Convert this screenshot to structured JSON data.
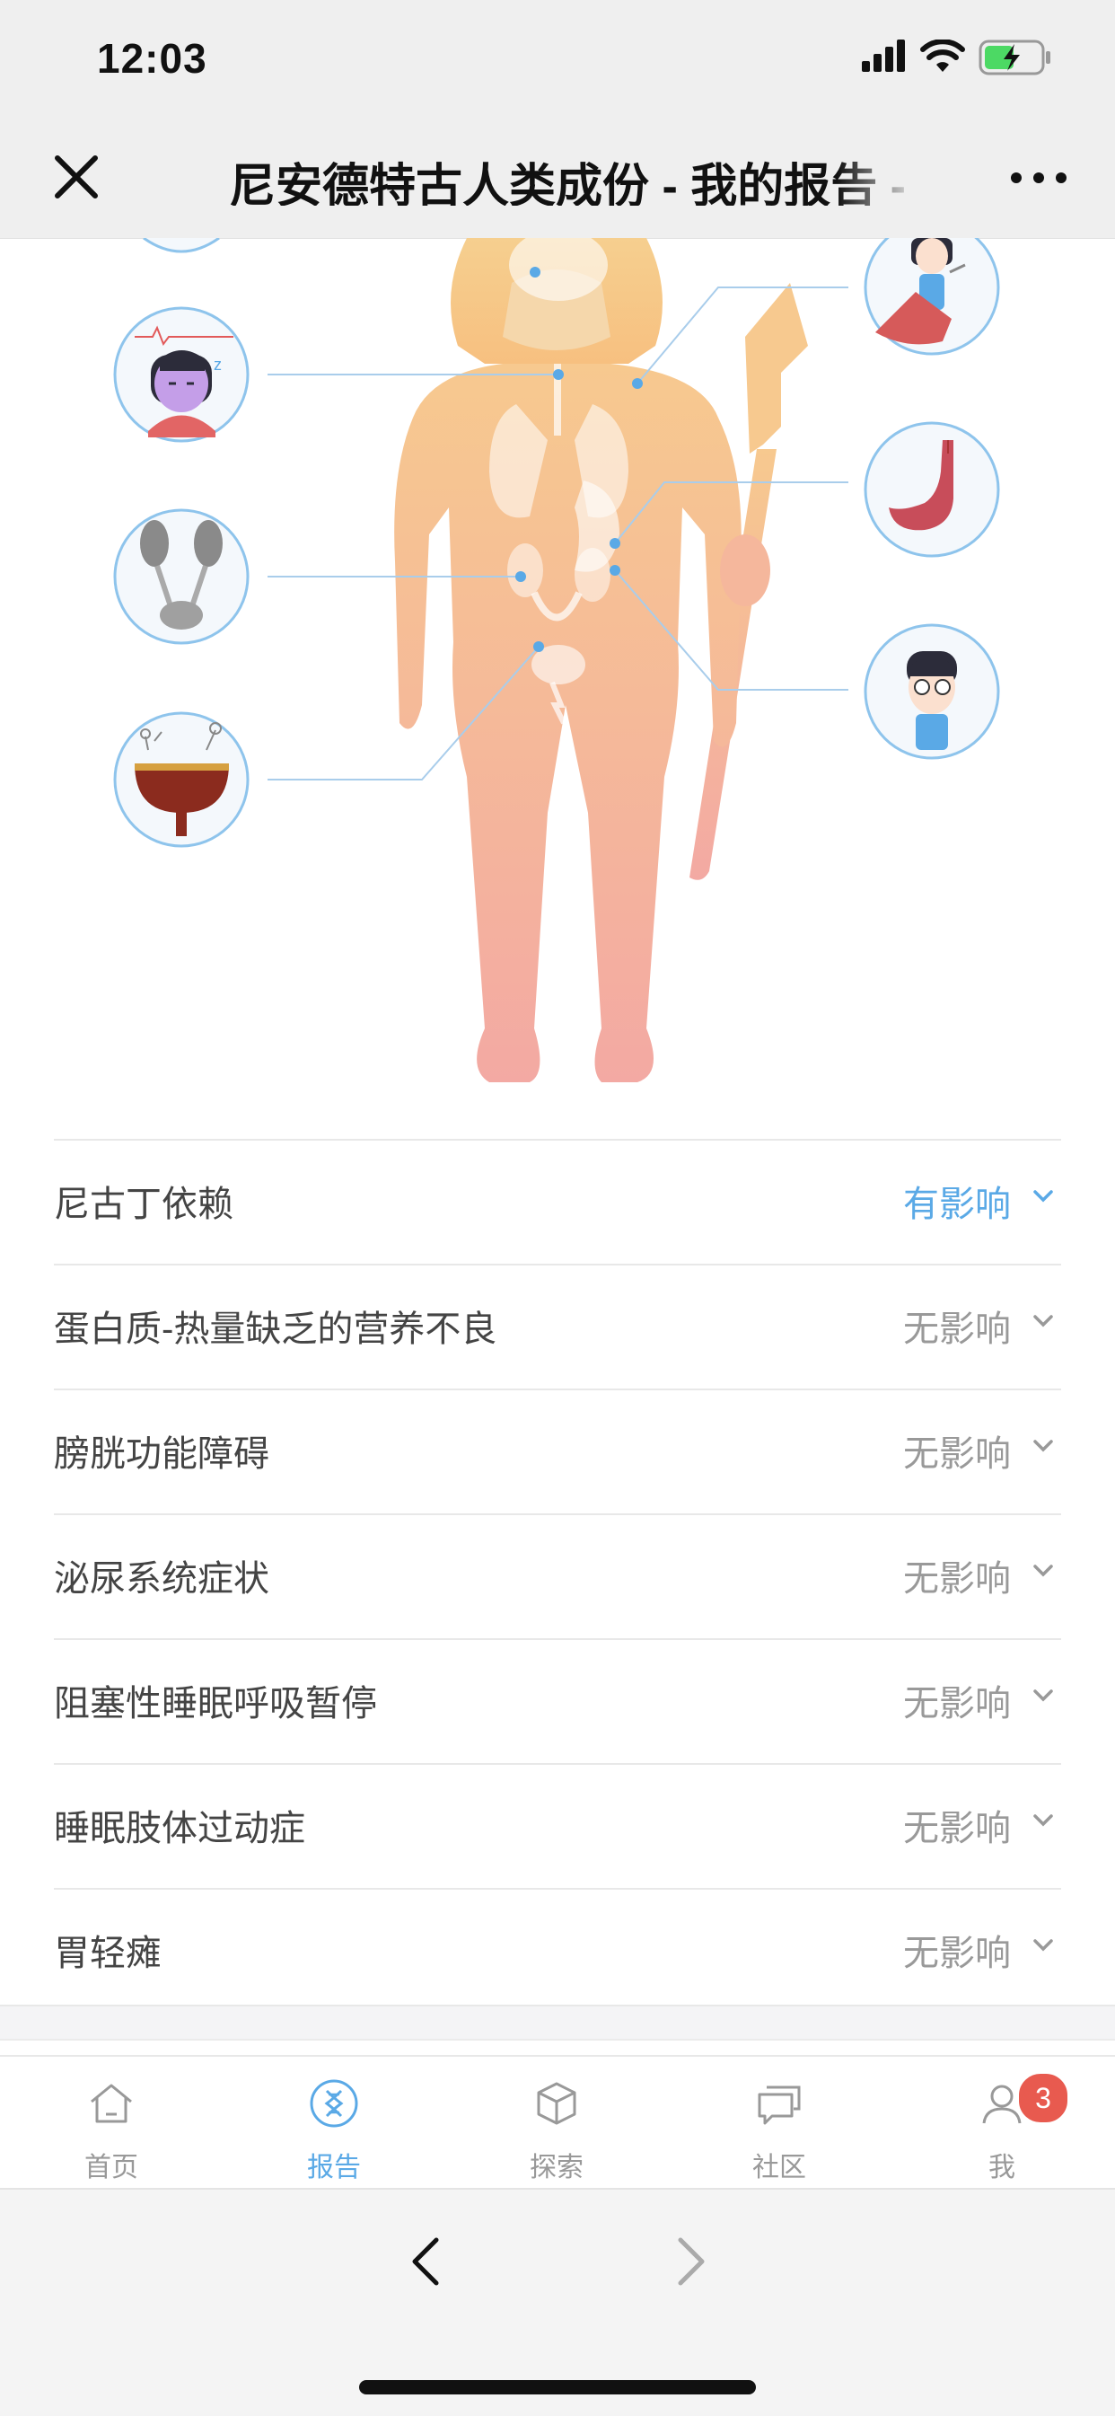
{
  "status_bar": {
    "time": "12:03"
  },
  "nav": {
    "title": "尼安德特古人类成份 - 我的报告 -",
    "close_icon": "close-icon",
    "more_icon": "more-icon"
  },
  "traits": [
    {
      "name": "尼古丁依赖",
      "status": "有影响",
      "affected": true
    },
    {
      "name": "蛋白质-热量缺乏的营养不良",
      "status": "无影响",
      "affected": false
    },
    {
      "name": "膀胱功能障碍",
      "status": "无影响",
      "affected": false
    },
    {
      "name": "泌尿系统症状",
      "status": "无影响",
      "affected": false
    },
    {
      "name": "阻塞性睡眠呼吸暂停",
      "status": "无影响",
      "affected": false
    },
    {
      "name": "睡眠肢体过动症",
      "status": "无影响",
      "affected": false
    },
    {
      "name": "胃轻瘫",
      "status": "无影响",
      "affected": false
    }
  ],
  "tabs": [
    {
      "label": "首页",
      "icon": "home-icon"
    },
    {
      "label": "报告",
      "icon": "dna-icon",
      "active": true
    },
    {
      "label": "探索",
      "icon": "cube-icon"
    },
    {
      "label": "社区",
      "icon": "chat-icon"
    },
    {
      "label": "我",
      "icon": "user-icon",
      "badge": "3"
    }
  ],
  "colors": {
    "accent": "#5aa9e6",
    "muted": "#999999",
    "badge": "#e85a4f",
    "figure_top": "#f7c98f",
    "figure_bottom": "#f3a9a3"
  }
}
